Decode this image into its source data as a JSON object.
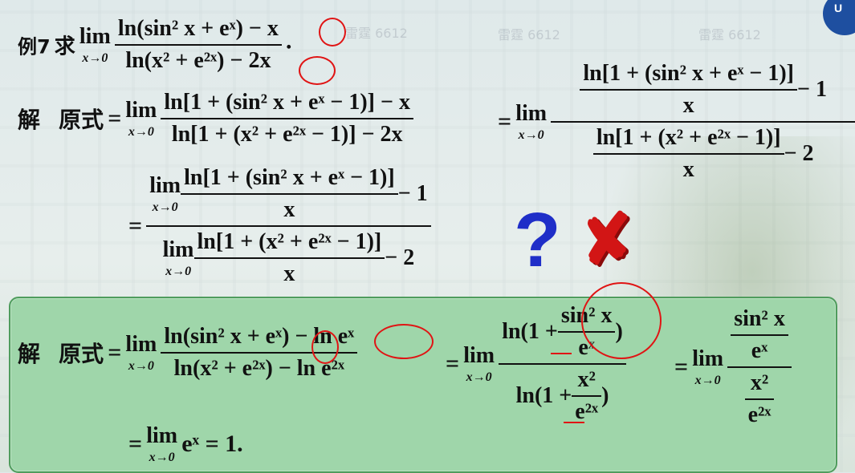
{
  "badge": {
    "text": "U"
  },
  "example": {
    "label": "例7",
    "ask": "求",
    "num": "ln(sin² x + eˣ) − x",
    "den": "ln(x² + e²ˣ) − 2x",
    "period": "."
  },
  "lim": {
    "word": "lim",
    "sub": "x→0"
  },
  "solution": {
    "jie": "解",
    "yuanshi": "原式"
  },
  "line1": {
    "num": "ln[1 + (sin² x + eˣ − 1)] − x",
    "den": "ln[1 + (x² + e²ˣ − 1)] − 2x",
    "right_num_inner": "ln[1 + (sin² x + eˣ − 1)]",
    "right_num_x": "x",
    "right_num_tail": "− 1",
    "right_den_inner": "ln[1 + (x² + e²ˣ − 1)]",
    "right_den_x": "x",
    "right_den_tail": "− 2"
  },
  "line2": {
    "num_inner": "ln[1 + (sin² x + eˣ − 1)]",
    "num_x": "x",
    "num_tail": "− 1",
    "den_inner": "ln[1 + (x² + e²ˣ − 1)]",
    "den_x": "x",
    "den_tail": "− 2"
  },
  "marks": {
    "question": "?",
    "cross": "✘"
  },
  "green": {
    "num": "ln(sin² x + eˣ) − ln eˣ",
    "den": "ln(x² + e²ˣ) − ln e²ˣ",
    "mid_num_pre": "ln(1 +",
    "mid_num_frac_top": "sin² x",
    "mid_num_frac_bot": "eˣ",
    "mid_den_pre": "ln(1 +",
    "mid_den_frac_top": "x²",
    "mid_den_frac_bot": "e²ˣ",
    "close": ")",
    "right_top_top": "sin² x",
    "right_top_bot": "eˣ",
    "right_bot_top": "x²",
    "right_bot_bot": "e²ˣ",
    "final": "eˣ = 1."
  },
  "ops": {
    "eq": "="
  },
  "watermark": "雷霆 6612"
}
